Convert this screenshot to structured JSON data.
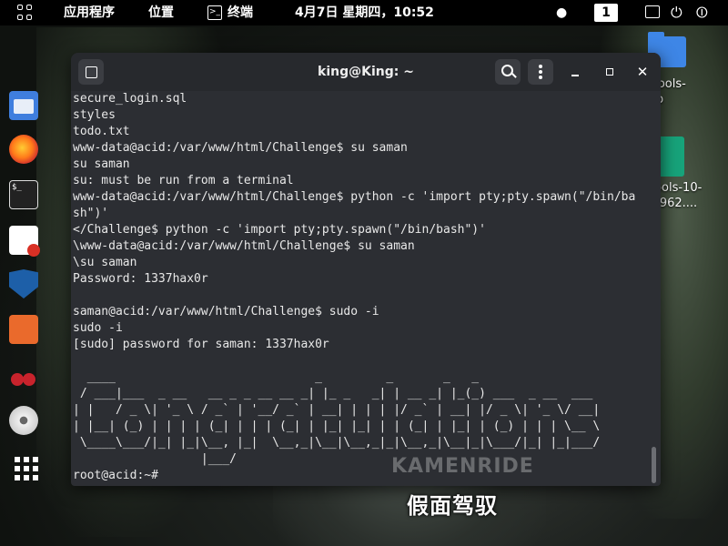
{
  "topbar": {
    "apps_label": "应用程序",
    "places_label": "位置",
    "terminal_label": "终端",
    "clock": "4月7日 星期四，10:52",
    "workspace": "1",
    "icons": [
      "apps-grid-icon",
      "terminal-icon",
      "camera-icon",
      "message-icon",
      "power-icon",
      "user-icon"
    ]
  },
  "dock": {
    "items": [
      "files-icon",
      "firefox-icon",
      "terminal-icon",
      "document-icon",
      "metasploit-icon",
      "burpsuite-icon",
      "cherrytree-icon",
      "disc-icon",
      "show-apps-icon"
    ]
  },
  "desktop": {
    "icon1_label": "re-tools-\nstrib",
    "icon2_label": "erTools-10-\n406962...."
  },
  "terminal": {
    "title": "king@King: ~",
    "lines": [
      "secure_login.sql",
      "styles",
      "todo.txt",
      "www-data@acid:/var/www/html/Challenge$ su saman",
      "su saman",
      "su: must be run from a terminal",
      "www-data@acid:/var/www/html/Challenge$ python -c 'import pty;pty.spawn(\"/bin/ba",
      "sh\")'",
      "</Challenge$ python -c 'import pty;pty.spawn(\"/bin/bash\")'",
      "\\www-data@acid:/var/www/html/Challenge$ su saman",
      "\\su saman",
      "Password: 1337hax0r",
      "",
      "saman@acid:/var/www/html/Challenge$ sudo -i",
      "sudo -i",
      "[sudo] password for saman: 1337hax0r",
      "",
      "  ____                            _         _       _   _",
      " / ___|___  _ __   __ _ _ __ __ _| |_ _   _| | __ _| |_(_) ___  _ __  ___",
      "| |   / _ \\| '_ \\ / _` | '__/ _` | __| | | | |/ _` | __| |/ _ \\| '_ \\/ __|",
      "| |__| (_) | | | | (_| | | | (_| | |_| |_| | | (_| | |_| | (_) | | | \\__ \\",
      " \\____\\___/|_| |_|\\__, |_|  \\__,_|\\__|\\__,_|_|\\__,_|\\__|_|\\___/|_| |_|___/",
      "                  |___/",
      "root@acid:~#"
    ]
  },
  "overlay": {
    "subtitle": "假面驾驭",
    "watermark": "KAMENRIDE"
  }
}
